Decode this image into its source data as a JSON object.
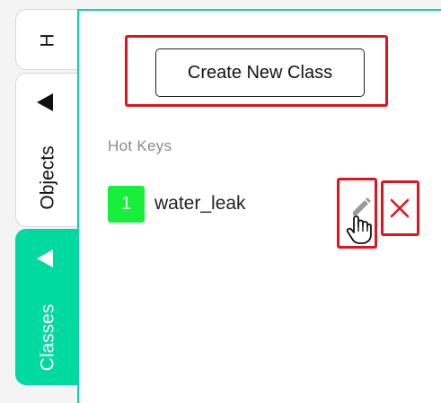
{
  "tabs": [
    {
      "label": "H"
    },
    {
      "label": "Objects"
    },
    {
      "label": "Classes"
    }
  ],
  "panel": {
    "create_button_label": "Create New Class",
    "section_label": "Hot Keys",
    "classes": [
      {
        "hotkey": "1",
        "name": "water_leak"
      }
    ]
  },
  "icons": {
    "edit": "pencil-icon",
    "delete": "close-icon",
    "cursor": "hand-pointer-icon",
    "collapse": "triangle-left-icon"
  },
  "colors": {
    "accent": "#00d9a0",
    "hotkey_badge": "#16f03a",
    "highlight": "#e0141e",
    "delete": "#e0141e"
  }
}
